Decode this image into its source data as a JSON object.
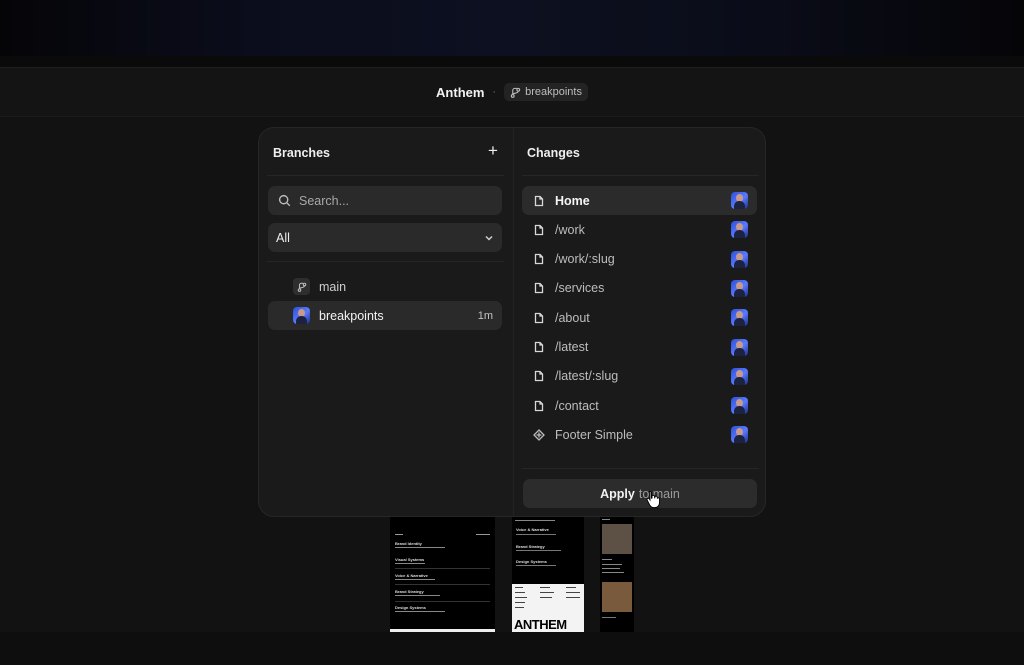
{
  "header": {
    "project_name": "Anthem",
    "separator": "·",
    "current_branch": "breakpoints"
  },
  "branches_panel": {
    "title": "Branches",
    "add_label": "+",
    "search_placeholder": "Search...",
    "filter_value": "All",
    "items": [
      {
        "name": "main",
        "time": "",
        "icon": "branch-icon"
      },
      {
        "name": "breakpoints",
        "time": "1m",
        "icon": "avatar",
        "active": true
      }
    ]
  },
  "changes_panel": {
    "title": "Changes",
    "items": [
      {
        "label": "Home",
        "icon": "page-icon",
        "active": true
      },
      {
        "label": "/work",
        "icon": "page-icon"
      },
      {
        "label": "/work/:slug",
        "icon": "page-icon"
      },
      {
        "label": "/services",
        "icon": "page-icon"
      },
      {
        "label": "/about",
        "icon": "page-icon"
      },
      {
        "label": "/latest",
        "icon": "page-icon"
      },
      {
        "label": "/latest/:slug",
        "icon": "page-icon"
      },
      {
        "label": "/contact",
        "icon": "page-icon"
      },
      {
        "label": "Footer Simple",
        "icon": "component-icon"
      }
    ],
    "apply_label_strong": "Apply",
    "apply_label_rest": "to main"
  },
  "previews": {
    "p1_items": [
      "Brand Identity",
      "Visual Systems",
      "Voice & Narrative",
      "Brand Strategy",
      "Design Systems"
    ],
    "p2_items": [
      "Voice & Narrative",
      "Brand Strategy",
      "Design Systems"
    ],
    "p2_logo": "ANTHEM"
  },
  "colors": {
    "panel_bg": "#1a1a1a",
    "row_active": "#2b2b2b",
    "avatar_blue": "#3b5cf0"
  }
}
